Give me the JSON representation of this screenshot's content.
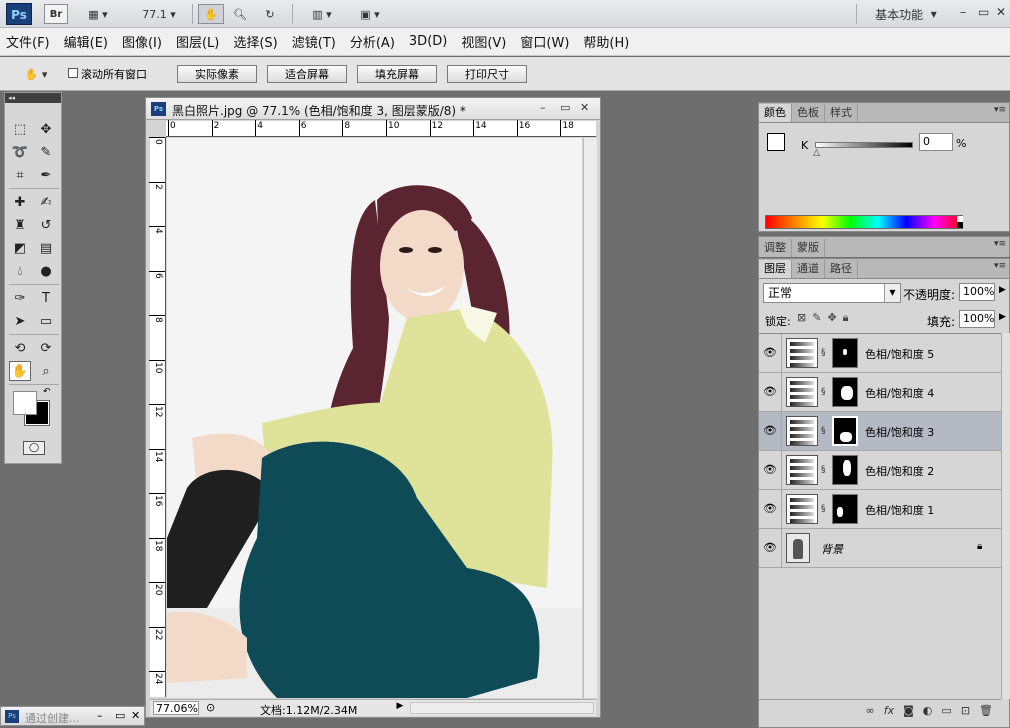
{
  "appbar": {
    "logo": "Ps",
    "bridge": "Br",
    "zoom": "77.1",
    "workspace": "基本功能",
    "controls": [
      "–",
      "▭",
      "✕"
    ]
  },
  "menus": [
    "文件(F)",
    "编辑(E)",
    "图像(I)",
    "图层(L)",
    "选择(S)",
    "滤镜(T)",
    "分析(A)",
    "3D(D)",
    "视图(V)",
    "窗口(W)",
    "帮助(H)"
  ],
  "options": {
    "scroll_all_label": "滚动所有窗口",
    "buttons": [
      "实际像素",
      "适合屏幕",
      "填充屏幕",
      "打印尺寸"
    ]
  },
  "document": {
    "title": "黑白照片.jpg @ 77.1% (色相/饱和度 3, 图层蒙版/8) *",
    "h_ruler": [
      "0",
      "2",
      "4",
      "6",
      "8",
      "10",
      "12",
      "14",
      "16",
      "18"
    ],
    "v_ruler": [
      "0",
      "2",
      "4",
      "6",
      "8",
      "10",
      "12",
      "14",
      "16",
      "18",
      "20",
      "22",
      "24"
    ],
    "zoom": "77.06%",
    "doc_size": "文档:1.12M/2.34M",
    "colors": {
      "hair": "#5a2530",
      "shirt": "#dfe39a",
      "skirt": "#0f4a57",
      "skin": "#f3d9c8",
      "legging": "#1f1f1f"
    }
  },
  "min_window": {
    "title": "通过创建..."
  },
  "color_panel": {
    "tabs": [
      "颜色",
      "色板",
      "样式"
    ],
    "k_label": "K",
    "k_value": "0",
    "k_unit": "%"
  },
  "adj_panel": {
    "tabs": [
      "调整",
      "蒙版"
    ]
  },
  "layers_panel": {
    "tabs": [
      "图层",
      "通道",
      "路径"
    ],
    "blend_mode": "正常",
    "opacity_label": "不透明度:",
    "opacity": "100%",
    "lock_label": "锁定:",
    "fill_label": "填充:",
    "fill": "100%",
    "layers": [
      {
        "name": "色相/饱和度 5",
        "selected": false
      },
      {
        "name": "色相/饱和度 4",
        "selected": false
      },
      {
        "name": "色相/饱和度 3",
        "selected": true
      },
      {
        "name": "色相/饱和度 2",
        "selected": false
      },
      {
        "name": "色相/饱和度 1",
        "selected": false
      }
    ],
    "background_layer": "背景"
  }
}
